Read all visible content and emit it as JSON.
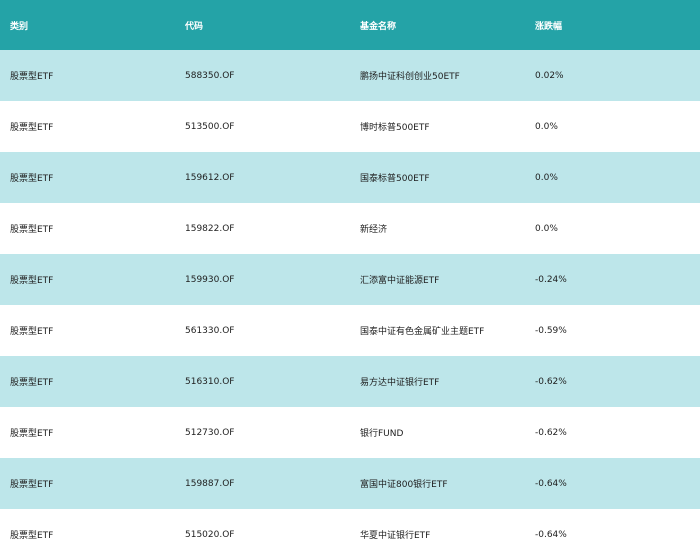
{
  "colors": {
    "header_bg": "#24a3a7",
    "row_alt_bg": "#bde6ea",
    "row_plain_bg": "#ffffff"
  },
  "table": {
    "headers": [
      "类别",
      "代码",
      "基金名称",
      "涨跌幅"
    ],
    "rows": [
      [
        "股票型ETF",
        "588350.OF",
        "鹏扬中证科创创业50ETF",
        "0.02%"
      ],
      [
        "股票型ETF",
        "513500.OF",
        "博时标普500ETF",
        "0.0%"
      ],
      [
        "股票型ETF",
        "159612.OF",
        "国泰标普500ETF",
        "0.0%"
      ],
      [
        "股票型ETF",
        "159822.OF",
        "新经济",
        "0.0%"
      ],
      [
        "股票型ETF",
        "159930.OF",
        "汇添富中证能源ETF",
        "-0.24%"
      ],
      [
        "股票型ETF",
        "561330.OF",
        "国泰中证有色金属矿业主题ETF",
        "-0.59%"
      ],
      [
        "股票型ETF",
        "516310.OF",
        "易方达中证银行ETF",
        "-0.62%"
      ],
      [
        "股票型ETF",
        "512730.OF",
        "银行FUND",
        "-0.62%"
      ],
      [
        "股票型ETF",
        "159887.OF",
        "富国中证800银行ETF",
        "-0.64%"
      ],
      [
        "股票型ETF",
        "515020.OF",
        "华夏中证银行ETF",
        "-0.64%"
      ]
    ]
  }
}
